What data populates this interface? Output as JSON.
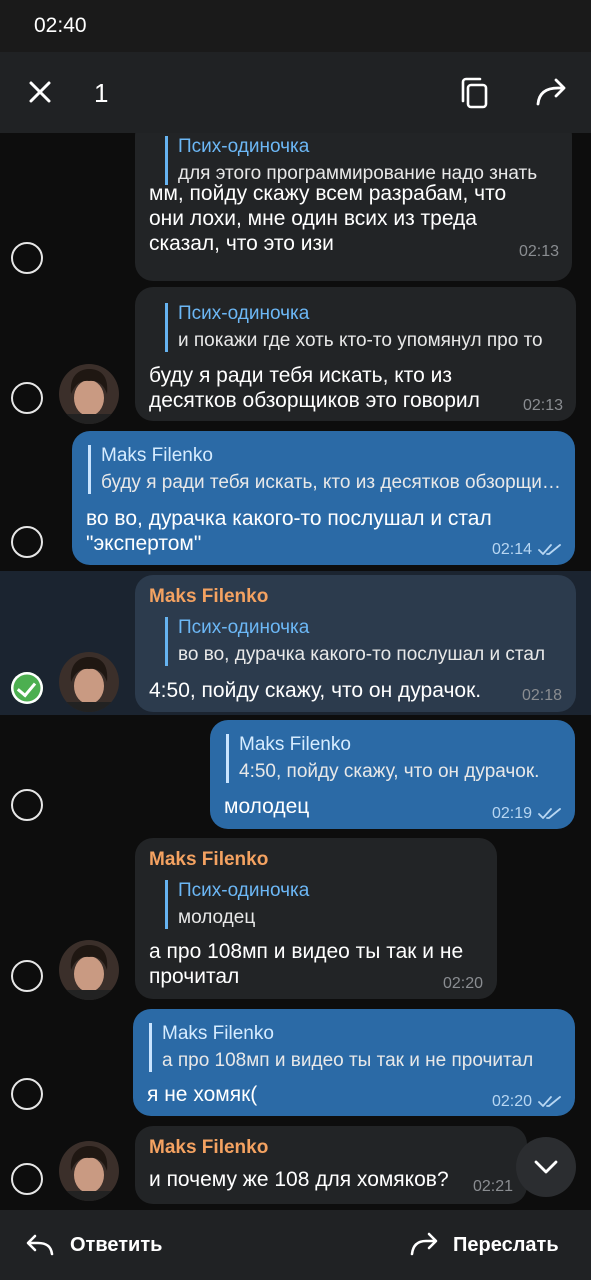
{
  "status_bar": {
    "time": "02:40"
  },
  "action_bar": {
    "selected_count": "1"
  },
  "messages": [
    {
      "direction": "in",
      "reply_name": "Псих-одиночка",
      "reply_text": "для этого программирование надо знать",
      "text": [
        "мм, пойду скажу всем разрабам, что",
        "они лохи, мне один всих из треда",
        "сказал, что это изи"
      ],
      "time": "02:13"
    },
    {
      "direction": "in",
      "reply_name": "Псих-одиночка",
      "reply_text": "и покажи где хоть кто-то упомянул про то",
      "text": [
        "буду я ради тебя искать, кто из",
        "десятков обзорщиков это говорил"
      ],
      "time": "02:13"
    },
    {
      "direction": "out",
      "reply_name": "Maks Filenko",
      "reply_text": "буду я ради тебя искать, кто из десятков обзорщиков",
      "text": [
        "во во, дурачка какого-то послушал и стал",
        "\"экспертом\""
      ],
      "time": "02:14"
    },
    {
      "direction": "in",
      "selected": true,
      "sender": "Maks Filenko",
      "reply_name": "Псих-одиночка",
      "reply_text": "во во, дурачка какого-то послушал и стал",
      "text": [
        "4:50, пойду скажу, что он дурачок."
      ],
      "time": "02:18"
    },
    {
      "direction": "out",
      "reply_name": "Maks Filenko",
      "reply_text": "4:50, пойду скажу, что он дурачок.",
      "text": [
        "молодец"
      ],
      "time": "02:19"
    },
    {
      "direction": "in",
      "sender": "Maks Filenko",
      "reply_name": "Псих-одиночка",
      "reply_text": "молодец",
      "text": [
        "а про 108мп и видео ты так и не",
        "прочитал"
      ],
      "time": "02:20"
    },
    {
      "direction": "out",
      "reply_name": "Maks Filenko",
      "reply_text": "а про 108мп и видео ты так и не прочитал",
      "text": [
        "я не хомяк("
      ],
      "time": "02:20"
    },
    {
      "direction": "in",
      "sender": "Maks Filenko",
      "text": [
        "и почему же 108 для хомяков?"
      ],
      "time": "02:21"
    }
  ],
  "bottom_bar": {
    "reply_label": "Ответить",
    "forward_label": "Переслать"
  },
  "colors": {
    "outgoing_bubble": "#2b6aa6",
    "incoming_bubble": "#222426",
    "sender_name": "#f4a261",
    "reply_name": "#6cb7f5",
    "selected_check": "#4caf50"
  }
}
